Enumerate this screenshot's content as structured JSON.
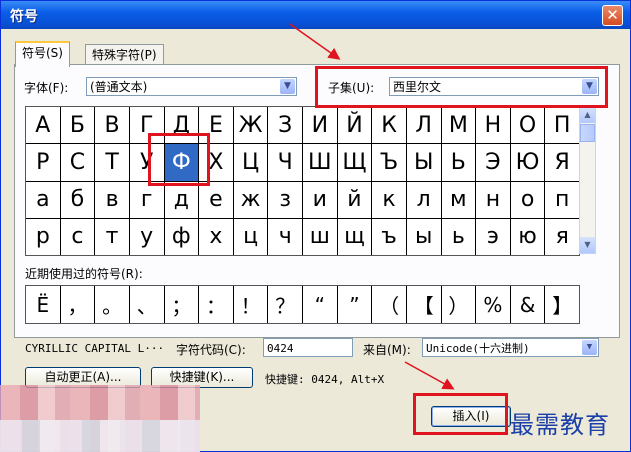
{
  "window": {
    "title": "符号",
    "close_glyph": "✕"
  },
  "tabs": [
    {
      "label": "符号(S)"
    },
    {
      "label": "特殊字符(P)"
    }
  ],
  "font": {
    "label": "字体(F):",
    "value": "(普通文本)"
  },
  "subset": {
    "label": "子集(U):",
    "value": "西里尔文"
  },
  "grid": {
    "selected": "Ф",
    "rows": [
      [
        "А",
        "Б",
        "В",
        "Г",
        "Д",
        "Е",
        "Ж",
        "З",
        "И",
        "Й",
        "К",
        "Л",
        "М",
        "Н",
        "О",
        "П"
      ],
      [
        "Р",
        "С",
        "Т",
        "У",
        "Ф",
        "Х",
        "Ц",
        "Ч",
        "Ш",
        "Щ",
        "Ъ",
        "Ы",
        "Ь",
        "Э",
        "Ю",
        "Я"
      ],
      [
        "а",
        "б",
        "в",
        "г",
        "д",
        "е",
        "ж",
        "з",
        "и",
        "й",
        "к",
        "л",
        "м",
        "н",
        "о",
        "п"
      ],
      [
        "р",
        "с",
        "т",
        "у",
        "ф",
        "х",
        "ц",
        "ч",
        "ш",
        "щ",
        "ъ",
        "ы",
        "ь",
        "э",
        "ю",
        "я"
      ]
    ]
  },
  "recent": {
    "label": "近期使用过的符号(R):",
    "symbols": [
      "Ё",
      "，",
      "。",
      "、",
      "；",
      "：",
      "！",
      "？",
      "“",
      "”",
      "（",
      "【",
      "）",
      "%",
      "&",
      "】"
    ]
  },
  "char_name": "CYRILLIC CAPITAL L···",
  "char_code": {
    "label": "字符代码(C):",
    "value": "0424"
  },
  "from": {
    "label": "来自(M):",
    "value": "Unicode(十六进制)"
  },
  "buttons": {
    "autocorrect": "自动更正(A)...",
    "shortcut_key": "快捷键(K)...",
    "insert": "插入(I)"
  },
  "shortcut_text": "快捷键: 0424, Alt+X",
  "watermark": "最需教育",
  "colors": {
    "accent": "#316ac5",
    "highlight": "#e0141e"
  }
}
